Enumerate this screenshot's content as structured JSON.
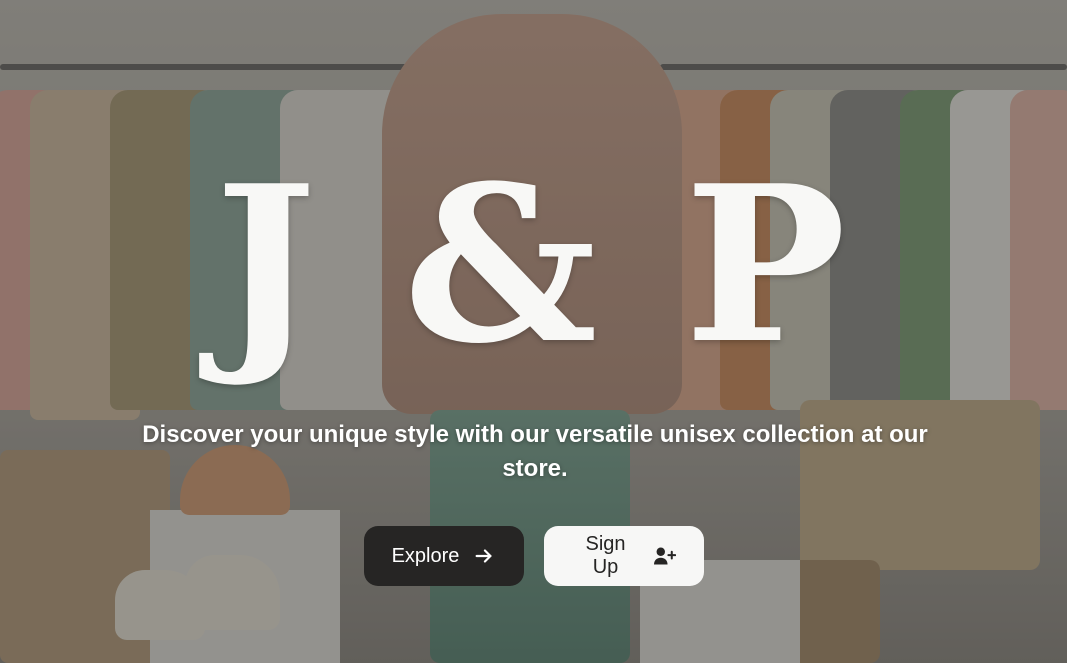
{
  "hero": {
    "logo": "J & P",
    "tagline": "Discover your unique style with our versatile unisex collection at our store."
  },
  "buttons": {
    "explore_label": "Explore",
    "explore_icon": "arrow-right-icon",
    "signup_label": "Sign Up",
    "signup_icon": "user-plus-icon"
  },
  "colors": {
    "explore_bg": "#262524",
    "signup_bg": "#f7f7f6",
    "text_light": "#ffffff"
  }
}
